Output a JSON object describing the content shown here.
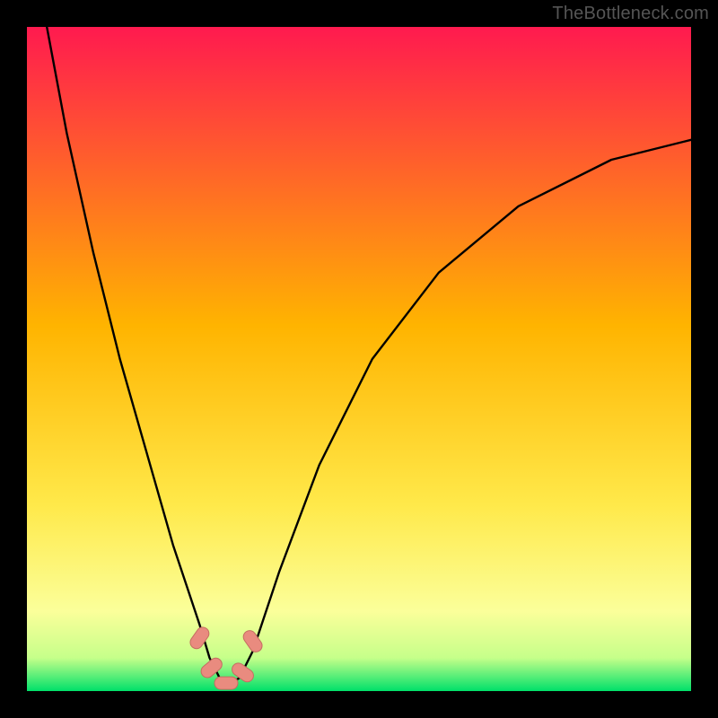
{
  "watermark": "TheBottleneck.com",
  "colors": {
    "bg_black": "#000000",
    "grad_top": "#ff1a4f",
    "grad_mid": "#ffb400",
    "grad_yellow": "#ffe94a",
    "grad_pale": "#fbff9a",
    "grad_green": "#00e06a",
    "curve": "#000000",
    "marker_fill": "#e98b7f",
    "marker_stroke": "#c46d60"
  },
  "chart_data": {
    "type": "line",
    "title": "",
    "xlabel": "",
    "ylabel": "",
    "xlim": [
      0,
      100
    ],
    "ylim": [
      0,
      100
    ],
    "grid": false,
    "legend": false,
    "series": [
      {
        "name": "bottleneck-curve",
        "x": [
          3,
          6,
          10,
          14,
          18,
          22,
          26,
          27.5,
          29,
          30.5,
          32,
          34,
          38,
          44,
          52,
          62,
          74,
          88,
          100
        ],
        "y": [
          100,
          84,
          66,
          50,
          36,
          22,
          10,
          5,
          2,
          1,
          2,
          6,
          18,
          34,
          50,
          63,
          73,
          80,
          83
        ]
      }
    ],
    "markers": [
      {
        "x": 26.0,
        "y": 8.0
      },
      {
        "x": 27.8,
        "y": 3.5
      },
      {
        "x": 30.0,
        "y": 1.2
      },
      {
        "x": 32.5,
        "y": 2.8
      },
      {
        "x": 34.0,
        "y": 7.5
      }
    ]
  }
}
